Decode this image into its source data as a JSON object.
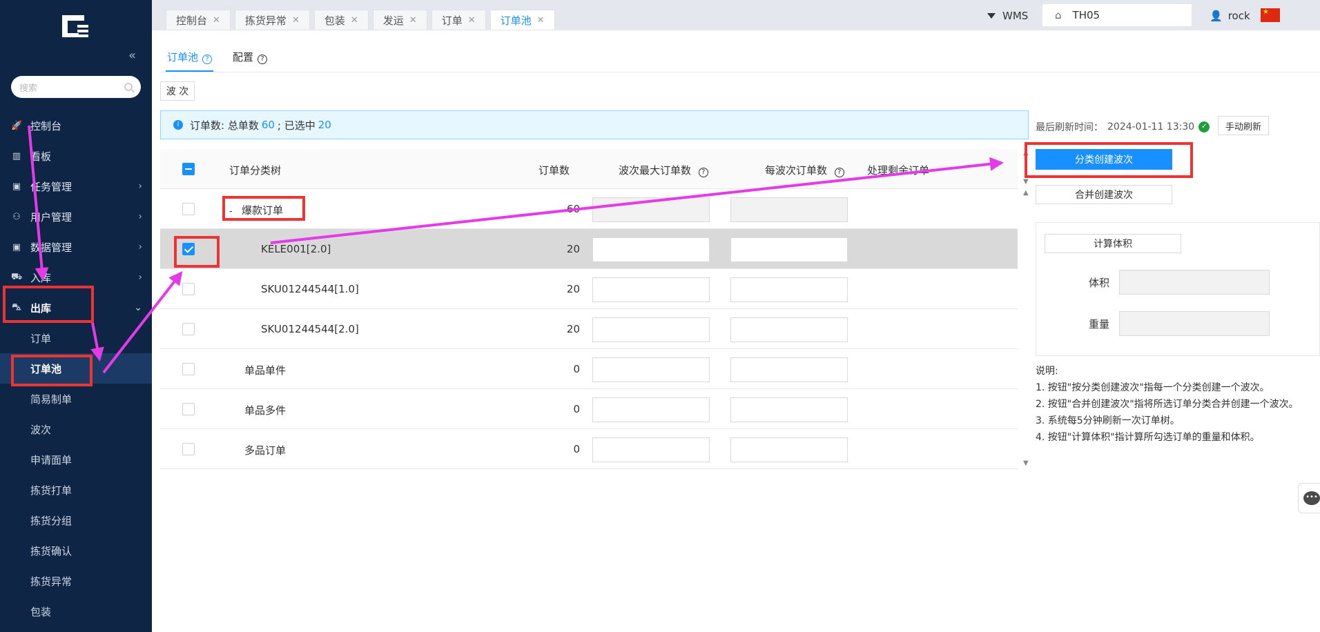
{
  "sidebar": {
    "search_placeholder": "搜索",
    "menu": [
      {
        "label": "控制台",
        "icon": "rocket-icon",
        "glyph": "🚀"
      },
      {
        "label": "看板",
        "icon": "bar-chart-icon",
        "glyph": "▥"
      },
      {
        "label": "任务管理",
        "icon": "box-icon",
        "glyph": "▣"
      },
      {
        "label": "用户管理",
        "icon": "users-icon",
        "glyph": "⚇"
      },
      {
        "label": "数据管理",
        "icon": "database-icon",
        "glyph": "▣"
      },
      {
        "label": "入库",
        "icon": "cart-icon",
        "glyph": "⛟"
      },
      {
        "label": "出库",
        "icon": "truck-icon",
        "glyph": "⛍"
      }
    ],
    "submenu": [
      "订单",
      "订单池",
      "简易制单",
      "波次",
      "申请面单",
      "拣货打单",
      "拣货分组",
      "拣货确认",
      "拣货异常",
      "包装"
    ]
  },
  "topbar": {
    "tabs": [
      "控制台",
      "拣货异常",
      "包装",
      "发运",
      "订单",
      "订单池"
    ],
    "app": "WMS",
    "warehouse": "TH05",
    "user": "rock"
  },
  "content": {
    "tabs": [
      "订单池",
      "配置"
    ],
    "wave_button": "波 次",
    "info": {
      "prefix": "订单数: 总单数",
      "total": "60",
      "mid": "; 已选中",
      "selected": "20"
    },
    "table": {
      "headers": [
        "订单分类树",
        "订单数",
        "波次最大订单数",
        "每波次订单数",
        "处理剩余订单"
      ],
      "rows": [
        {
          "name": "爆款订单",
          "count": "60",
          "expand": "-"
        },
        {
          "name": "KELE001[2.0]",
          "count": "20"
        },
        {
          "name": "SKU01244544[1.0]",
          "count": "20"
        },
        {
          "name": "SKU01244544[2.0]",
          "count": "20"
        },
        {
          "name": "单品单件",
          "count": "0"
        },
        {
          "name": "单品多件",
          "count": "0"
        },
        {
          "name": "多品订单",
          "count": "0"
        }
      ]
    }
  },
  "right_panel": {
    "refresh_label": "最后刷新时间：",
    "refresh_time": "2024-01-11 13:30",
    "manual_refresh": "手动刷新",
    "create_by_category": "分类创建波次",
    "merge_create": "合并创建波次",
    "calc_volume": "计算体积",
    "volume_label": "体积",
    "weight_label": "重量",
    "notes_title": "说明:",
    "notes": [
      "1. 按钮\"按分类创建波次\"指每一个分类创建一个波次。",
      "2. 按钮\"合并创建波次\"指将所选订单分类合并创建一个波次。",
      "3. 系统每5分钟刷新一次订单树。",
      "4. 按钮\"计算体积\"指计算所勾选订单的重量和体积。"
    ]
  },
  "colors": {
    "sidebar_bg": "#0f2546",
    "accent": "#1890ff",
    "annotation": "#ee3333",
    "arrow": "#e43ae8"
  }
}
